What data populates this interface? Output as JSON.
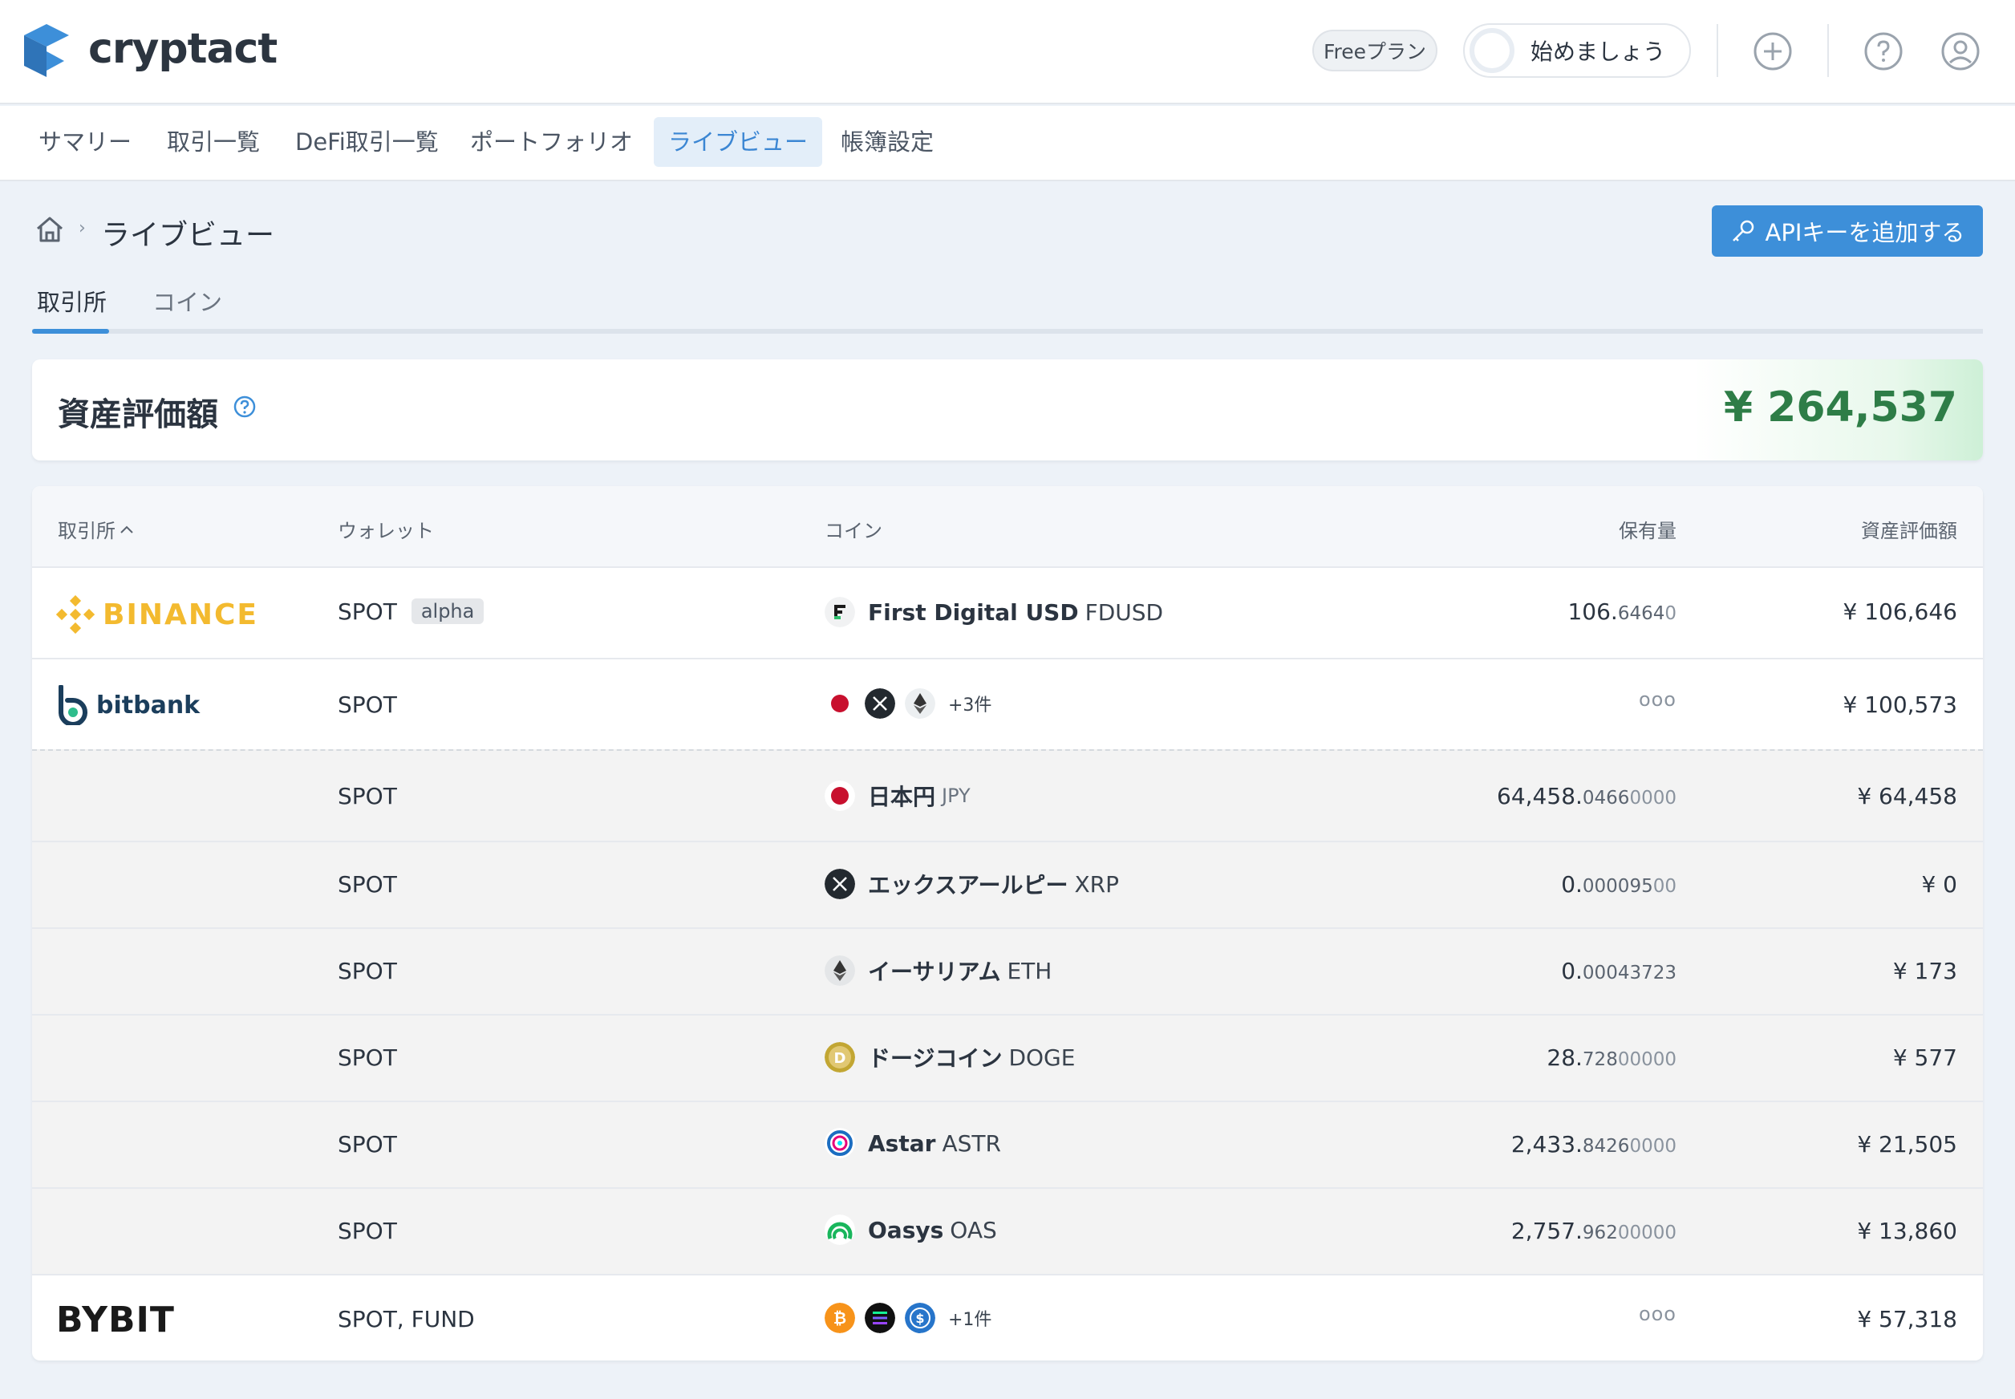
{
  "header": {
    "brand": "cryptact",
    "plan_label": "Freeプラン",
    "start_label": "始めましょう",
    "icons": [
      "plus-circle-icon",
      "help-circle-icon",
      "user-circle-icon"
    ],
    "colors": {
      "brand_blue": "#3d8fd9",
      "dark": "#2c3540"
    }
  },
  "nav": {
    "items": [
      {
        "label": "サマリー"
      },
      {
        "label": "取引一覧"
      },
      {
        "label": "DeFi取引一覧"
      },
      {
        "label": "ポートフォリオ"
      },
      {
        "label": "ライブビュー",
        "active": true
      },
      {
        "label": "帳簿設定"
      }
    ]
  },
  "breadcrumb": {
    "home_icon": "home-icon",
    "title": "ライブビュー"
  },
  "api_button": {
    "label": "APIキーを追加する",
    "icon": "key-icon"
  },
  "subtabs": {
    "items": [
      {
        "label": "取引所",
        "active": true
      },
      {
        "label": "コイン"
      }
    ]
  },
  "asset_summary": {
    "label": "資産評価額",
    "value": "¥ 264,537",
    "help_icon": "question-circle-icon",
    "value_color": "#2e7d47"
  },
  "table": {
    "headers": {
      "exchange": "取引所",
      "wallet": "ウォレット",
      "coin": "コイン",
      "holding": "保有量",
      "value": "資産評価額"
    },
    "sort_icon": "chevron-up-icon",
    "binance": {
      "logo": "BINANCE",
      "wallet": "SPOT",
      "badge": "alpha",
      "coin_name": "First Digital USD",
      "coin_symbol": "FDUSD",
      "holding_int": "106.",
      "holding_frac": "6464",
      "holding_zero": "0",
      "value": "¥ 106,646"
    },
    "bitbank": {
      "logo": "bitbank",
      "wallet": "SPOT",
      "more": "+3件",
      "dots": "ooo",
      "value": "¥ 100,573",
      "rows": [
        {
          "wallet": "SPOT",
          "name": "日本円",
          "symbol": "JPY",
          "h_int": "64,458.",
          "h_frac": "0466",
          "h_zero": "0000",
          "value": "¥ 64,458"
        },
        {
          "wallet": "SPOT",
          "name": "エックスアールピー",
          "symbol": "XRP",
          "h_int": "0.",
          "h_frac": "000095",
          "h_zero": "00",
          "value": "¥ 0"
        },
        {
          "wallet": "SPOT",
          "name": "イーサリアム",
          "symbol": "ETH",
          "h_int": "0.",
          "h_frac": "00043723",
          "h_zero": "",
          "value": "¥ 173"
        },
        {
          "wallet": "SPOT",
          "name": "ドージコイン",
          "symbol": "DOGE",
          "h_int": "28.",
          "h_frac": "728",
          "h_zero": "00000",
          "value": "¥ 577"
        },
        {
          "wallet": "SPOT",
          "name": "Astar",
          "symbol": "ASTR",
          "h_int": "2,433.",
          "h_frac": "8426",
          "h_zero": "0000",
          "value": "¥ 21,505"
        },
        {
          "wallet": "SPOT",
          "name": "Oasys",
          "symbol": "OAS",
          "h_int": "2,757.",
          "h_frac": "962",
          "h_zero": "00000",
          "value": "¥ 13,860"
        }
      ]
    },
    "bybit": {
      "logo": "BYBIT",
      "wallet": "SPOT, FUND",
      "more": "+1件",
      "dots": "ooo",
      "value": "¥ 57,318"
    }
  }
}
